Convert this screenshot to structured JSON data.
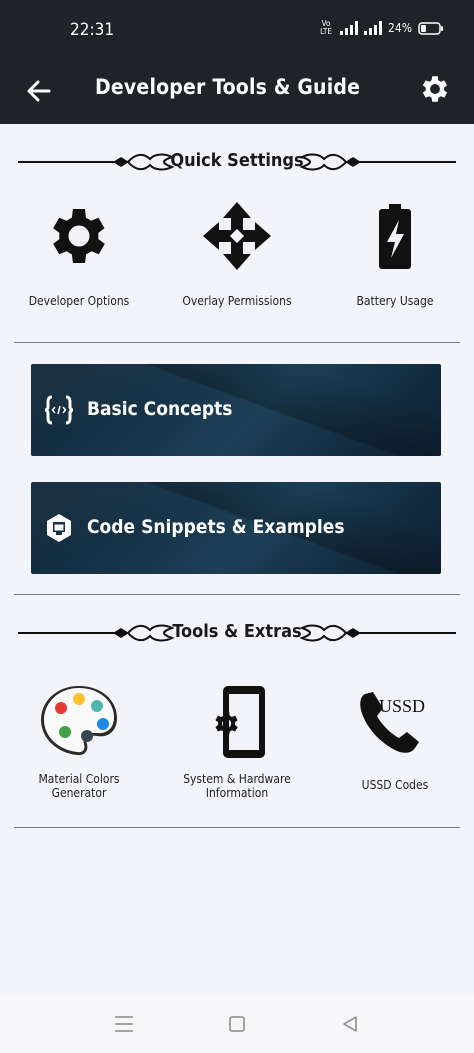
{
  "status_bar": {
    "time": "22:31",
    "network_label": "Vo LTE",
    "battery": "24%"
  },
  "app_bar": {
    "title": "Developer Tools & Guide",
    "back_icon": "arrow-left-icon",
    "settings_icon": "gear-icon"
  },
  "quick_settings": {
    "title": "Quick Settings",
    "items": [
      {
        "label": "Developer Options",
        "icon": "gear-icon"
      },
      {
        "label": "Overlay Permissions",
        "icon": "move-arrows-icon"
      },
      {
        "label": "Battery Usage",
        "icon": "battery-charging-icon"
      }
    ]
  },
  "banners": [
    {
      "label": "Basic Concepts",
      "icon": "code-braces-icon"
    },
    {
      "label": "Code Snippets & Examples",
      "icon": "code-snippet-icon"
    }
  ],
  "tools_extras": {
    "title": "Tools & Extras",
    "items": [
      {
        "label_line1": "Material Colors",
        "label_line2": "Generator",
        "icon": "palette-icon"
      },
      {
        "label_line1": "System & Hardware",
        "label_line2": "Information",
        "icon": "phone-settings-icon"
      },
      {
        "label_line1": "USSD Codes",
        "label_line2": "",
        "icon": "ussd-phone-icon",
        "icon_text": "USSD"
      }
    ]
  },
  "colors": {
    "app_bar": "#1f2227",
    "background": "#f3f4f9",
    "banner": "#163247",
    "palette": [
      "#e53935",
      "#fbc02d",
      "#4db6ac",
      "#1e88e5",
      "#43a047",
      "#37474f"
    ]
  },
  "nav_bar": {
    "icons": [
      "menu-icon",
      "home-square-icon",
      "back-triangle-icon"
    ]
  }
}
